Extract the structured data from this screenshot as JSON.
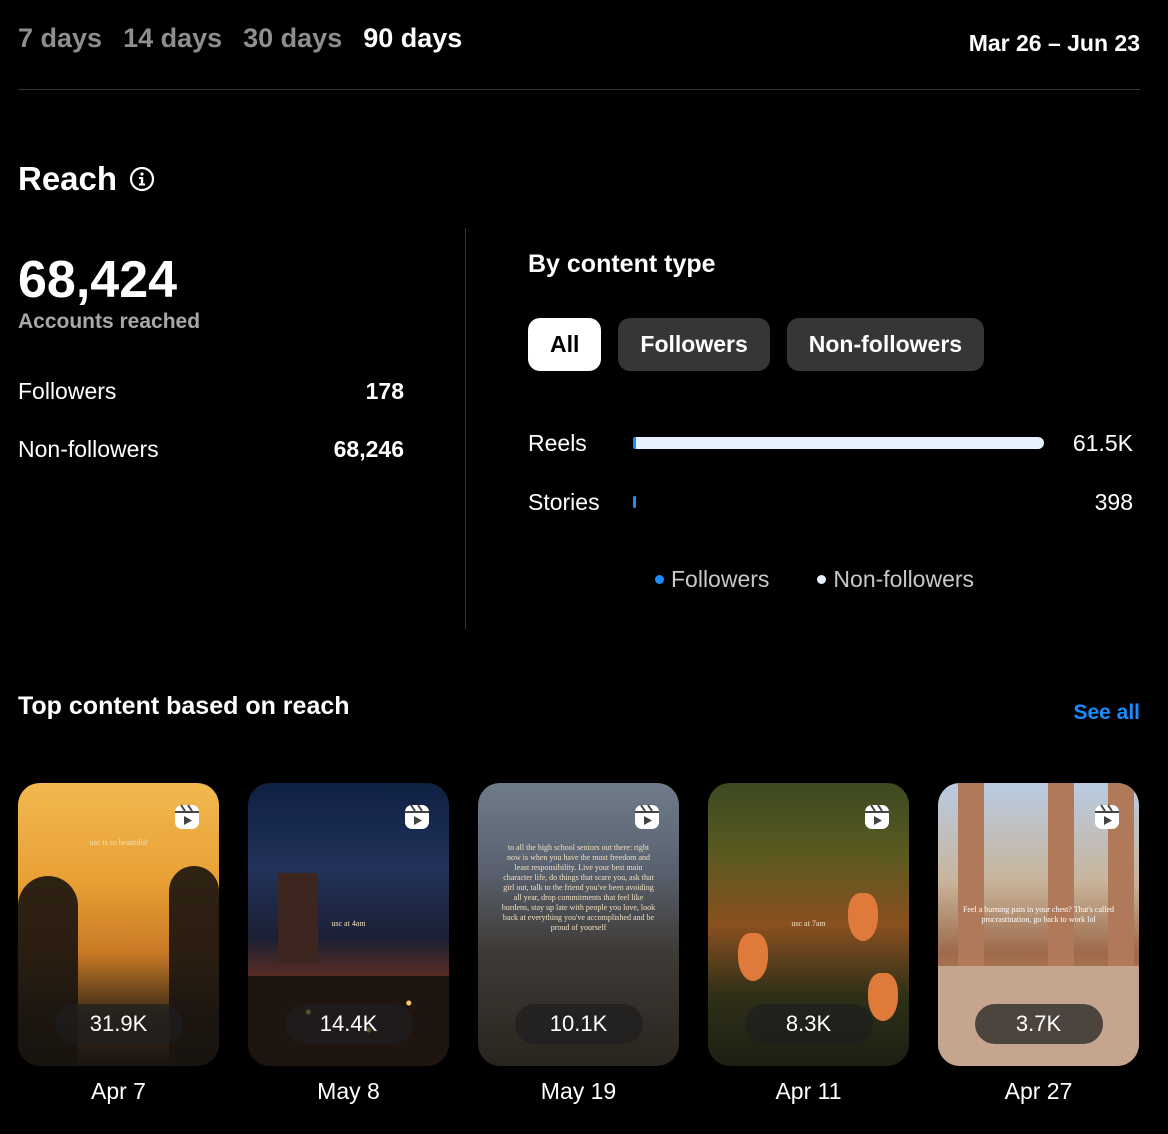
{
  "range_tabs": [
    {
      "label": "7 days",
      "active": false
    },
    {
      "label": "14 days",
      "active": false
    },
    {
      "label": "30 days",
      "active": false
    },
    {
      "label": "90 days",
      "active": true
    }
  ],
  "date_range": "Mar 26 – Jun 23",
  "reach": {
    "title": "Reach",
    "icon": "info-icon",
    "total": "68,424",
    "total_label": "Accounts reached",
    "followers_label": "Followers",
    "followers_value": "178",
    "nonfollowers_label": "Non-followers",
    "nonfollowers_value": "68,246"
  },
  "by_content_type": {
    "title": "By content type",
    "filters": [
      {
        "label": "All",
        "active": true
      },
      {
        "label": "Followers",
        "active": false
      },
      {
        "label": "Non-followers",
        "active": false
      }
    ],
    "rows": [
      {
        "label": "Reels",
        "value_label": "61.5K",
        "total": 61500,
        "followers_share": 0.005
      },
      {
        "label": "Stories",
        "value_label": "398",
        "total": 398,
        "followers_share": 1.0
      }
    ],
    "legend": {
      "followers": "Followers",
      "nonfollowers": "Non-followers"
    },
    "colors": {
      "followers": "#1a8cff",
      "nonfollowers": "#e6f2ff"
    }
  },
  "top_content": {
    "title": "Top content based on reach",
    "see_all": "See all",
    "icon": "reel-icon",
    "items": [
      {
        "count": "31.9K",
        "date": "Apr 7",
        "overlay": "usc is so beautiful"
      },
      {
        "count": "14.4K",
        "date": "May 8",
        "overlay": "usc at 4am"
      },
      {
        "count": "10.1K",
        "date": "May 19",
        "overlay": "to all the high school seniors out there: right now is when you have the most freedom and least responsibility. Live your best main character life, do things that scare you, ask that girl out, talk to the friend you've been avoiding all year, drop commitments that feel like burdens, stay up late with people you love, look back at everything you've accomplished and be proud of yourself"
      },
      {
        "count": "8.3K",
        "date": "Apr 11",
        "overlay": "usc at 7am"
      },
      {
        "count": "3.7K",
        "date": "Apr 27",
        "overlay": "Feel a burning pain in your chest? That's called procrastination, go back to work lol"
      }
    ]
  }
}
